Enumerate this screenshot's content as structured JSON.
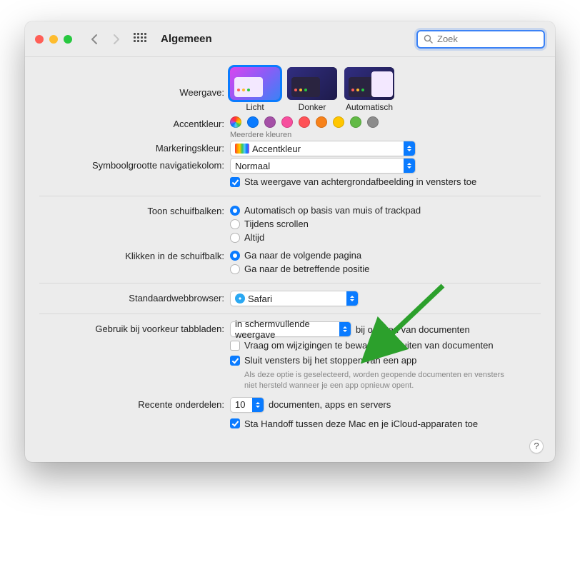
{
  "toolbar": {
    "title": "Algemeen",
    "search_placeholder": "Zoek"
  },
  "appearance": {
    "label": "Weergave:",
    "options": [
      "Licht",
      "Donker",
      "Automatisch"
    ],
    "selected": 0
  },
  "accent": {
    "label": "Accentkleur:",
    "sublabel": "Meerdere kleuren",
    "colors": [
      "#multi",
      "#0a7bff",
      "#a550a7",
      "#f74f9e",
      "#ff5257",
      "#f7821b",
      "#ffc600",
      "#62ba46",
      "#8c8c8c"
    ]
  },
  "highlight": {
    "label": "Markeringskleur:",
    "value": "Accentkleur"
  },
  "sidebar_size": {
    "label": "Symboolgrootte navigatiekolom:",
    "value": "Normaal"
  },
  "wallpaper_tint": {
    "label": "Sta weergave van achtergrondafbeelding in vensters toe",
    "checked": true
  },
  "scrollbars": {
    "label": "Toon schuifbalken:",
    "options": [
      "Automatisch op basis van muis of trackpad",
      "Tijdens scrollen",
      "Altijd"
    ],
    "selected": 0
  },
  "scroll_click": {
    "label": "Klikken in de schuifbalk:",
    "options": [
      "Ga naar de volgende pagina",
      "Ga naar de betreffende positie"
    ],
    "selected": 0
  },
  "browser": {
    "label": "Standaardwebbrowser:",
    "value": "Safari"
  },
  "tabs": {
    "label": "Gebruik bij voorkeur tabbladen:",
    "value": "in schermvullende weergave",
    "suffix": "bij openen van documenten"
  },
  "ask_save": {
    "label": "Vraag om wijzigingen te bewaren bij sluiten van documenten",
    "checked": false
  },
  "close_windows": {
    "label": "Sluit vensters bij het stoppen van een app",
    "checked": true,
    "help": "Als deze optie is geselecteerd, worden geopende documenten en vensters niet hersteld wanneer je een app opnieuw opent."
  },
  "recent": {
    "label": "Recente onderdelen:",
    "value": "10",
    "suffix": "documenten, apps en servers"
  },
  "handoff": {
    "label": "Sta Handoff tussen deze Mac en je iCloud-apparaten toe",
    "checked": true
  }
}
